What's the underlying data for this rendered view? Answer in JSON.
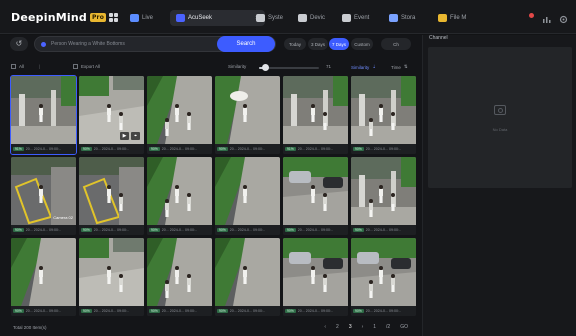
{
  "app": {
    "name": "DeepinMind",
    "badge": "Pro"
  },
  "tabs": [
    {
      "label": "Live",
      "icon": "live-icon",
      "color": "#5c8dff"
    },
    {
      "label": "AcuSeek",
      "icon": "acuseek-icon",
      "color": "#4b63ff",
      "active": true
    },
    {
      "label": "Syste",
      "icon": "system-icon",
      "color": "#c9ccd1"
    },
    {
      "label": "Devic",
      "icon": "device-icon",
      "color": "#c9ccd1"
    },
    {
      "label": "Event",
      "icon": "event-icon",
      "color": "#c9ccd1"
    },
    {
      "label": "Stora",
      "icon": "storage-icon",
      "color": "#7aa2ff"
    },
    {
      "label": "File M",
      "icon": "file-manager-icon",
      "color": "#e9b730"
    }
  ],
  "search": {
    "placeholder": "Person Wearing a White Bottoms",
    "button": "Search"
  },
  "time_ranges": [
    {
      "label": "Today"
    },
    {
      "label": "3 Days"
    },
    {
      "label": "7 Days",
      "selected": true
    },
    {
      "label": "Custom"
    },
    {
      "label": "Ch"
    }
  ],
  "filters": {
    "all_label": "All",
    "export_label": "Export All",
    "similarity_label": "Similarity",
    "similarity_value": "71",
    "similarity_level": 0.1,
    "sort_label": "Similarity",
    "time_label": "Time"
  },
  "results": [
    {
      "score": "91%",
      "time": "20... 2024-0... 09:00:..",
      "scene": "entrance",
      "selected": true
    },
    {
      "score": "90%",
      "time": "20... 2024-0... 09:00:..",
      "scene": "plaza",
      "controls": true
    },
    {
      "score": "90%",
      "time": "20... 2024-0... 09:00:..",
      "scene": "road"
    },
    {
      "score": "90%",
      "time": "20... 2024-0... 09:00:..",
      "scene": "umbrella"
    },
    {
      "score": "91%",
      "time": "20... 2024-0... 09:00:..",
      "scene": "entrance"
    },
    {
      "score": "90%",
      "time": "20... 2024-0... 09:00:..",
      "scene": "entrance"
    },
    {
      "score": "90%",
      "time": "20... 2024-0... 09:00:..",
      "scene": "crosswalk",
      "label": "Camera 02"
    },
    {
      "score": "90%",
      "time": "20... 2024-0... 09:00:..",
      "scene": "crosswalk"
    },
    {
      "score": "90%",
      "time": "20... 2024-0... 09:00:..",
      "scene": "road"
    },
    {
      "score": "90%",
      "time": "20... 2024-0... 09:00:..",
      "scene": "road"
    },
    {
      "score": "90%",
      "time": "20... 2024-0... 09:00:..",
      "scene": "parking"
    },
    {
      "score": "90%",
      "time": "20... 2024-0... 09:00:..",
      "scene": "entrance"
    },
    {
      "score": "90%",
      "time": "20... 2024-0... 09:00:..",
      "scene": "road"
    },
    {
      "score": "90%",
      "time": "20... 2024-0... 09:00:..",
      "scene": "plaza"
    },
    {
      "score": "90%",
      "time": "20... 2024-0... 09:00:..",
      "scene": "road"
    },
    {
      "score": "90%",
      "time": "20... 2024-0... 09:00:..",
      "scene": "road"
    },
    {
      "score": "90%",
      "time": "20... 2024-0... 09:00:..",
      "scene": "parking"
    },
    {
      "score": "90%",
      "time": "20... 2024-0... 09:00:..",
      "scene": "parking"
    }
  ],
  "footer": {
    "total": "Total 200 Item(s)",
    "pages": [
      "2",
      "3",
      "1"
    ],
    "page_size": "/2",
    "goto": "GO"
  },
  "side": {
    "title": "Channel",
    "empty": "No Data"
  }
}
